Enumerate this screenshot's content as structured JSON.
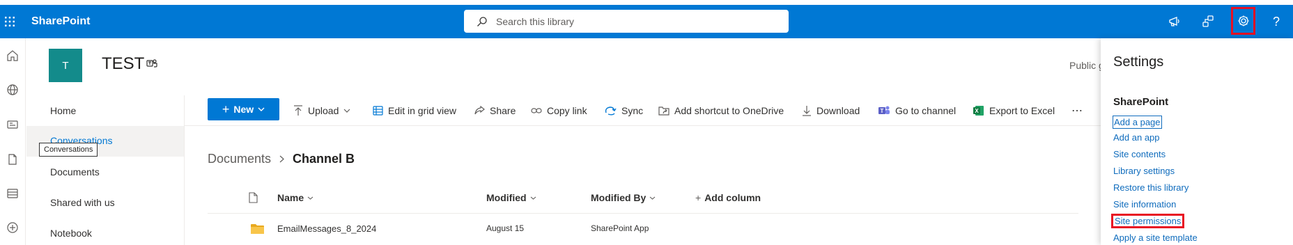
{
  "topbar": {
    "brand": "SharePoint",
    "search_placeholder": "Search this library",
    "colors": {
      "bar": "#0078d4",
      "highlight": "#e81123"
    }
  },
  "site": {
    "logo_letter": "T",
    "title": "TEST",
    "visibility": "Public g"
  },
  "nav": {
    "items": [
      "Home",
      "Conversations",
      "Documents",
      "Shared with us",
      "Notebook"
    ],
    "tooltip": "Conversations"
  },
  "commands": {
    "new": "New",
    "upload": "Upload",
    "edit_grid": "Edit in grid view",
    "share": "Share",
    "copy_link": "Copy link",
    "sync": "Sync",
    "add_shortcut": "Add shortcut to OneDrive",
    "download": "Download",
    "go_channel": "Go to channel",
    "export_excel": "Export to Excel",
    "more": "⋯"
  },
  "breadcrumb": {
    "root": "Documents",
    "current": "Channel B"
  },
  "columns": {
    "name": "Name",
    "modified": "Modified",
    "modified_by": "Modified By",
    "add_column": "Add column"
  },
  "rows": [
    {
      "name": "EmailMessages_8_2024",
      "modified": "August 15",
      "modified_by": "SharePoint App"
    }
  ],
  "settings": {
    "title": "Settings",
    "section": "SharePoint",
    "links": [
      "Add a page",
      "Add an app",
      "Site contents",
      "Library settings",
      "Restore this library",
      "Site information",
      "Site permissions",
      "Apply a site template"
    ]
  }
}
